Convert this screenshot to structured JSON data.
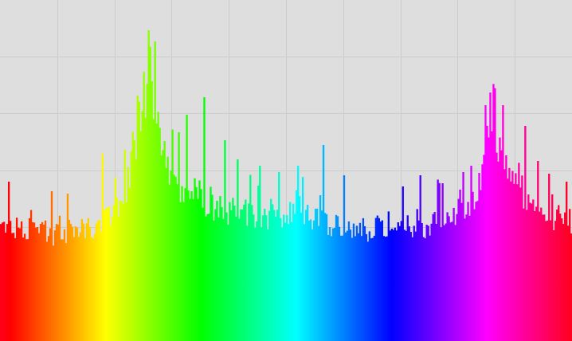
{
  "chart_data": {
    "type": "bar",
    "title": "",
    "xlabel": "",
    "ylabel": "",
    "xlim": [
      0,
      360
    ],
    "ylim": [
      0,
      428
    ],
    "grid": true,
    "grid_x": [
      36,
      72,
      108,
      144,
      180,
      216,
      252,
      288,
      324
    ],
    "grid_y": [
      357,
      286,
      214,
      143,
      71
    ],
    "background": "#dedede",
    "gridline_color": "#cccccc",
    "bar_color": "hue of bin (rainbow)",
    "series": [
      {
        "anchors": [
          [
            0,
            146
          ],
          [
            4,
            144
          ],
          [
            8,
            134
          ],
          [
            12,
            138
          ],
          [
            20,
            140
          ],
          [
            28,
            134
          ],
          [
            36,
            134
          ],
          [
            44,
            138
          ],
          [
            52,
            140
          ],
          [
            60,
            144
          ],
          [
            66,
            152
          ],
          [
            70,
            158
          ],
          [
            76,
            172
          ],
          [
            80,
            192
          ],
          [
            84,
            230
          ],
          [
            88,
            280
          ],
          [
            92,
            290
          ],
          [
            94,
            372
          ],
          [
            96,
            300
          ],
          [
            98,
            278
          ],
          [
            104,
            230
          ],
          [
            108,
            200
          ],
          [
            112,
            188
          ],
          [
            116,
            196
          ],
          [
            120,
            196
          ],
          [
            126,
            182
          ],
          [
            132,
            170
          ],
          [
            136,
            168
          ],
          [
            140,
            168
          ],
          [
            144,
            162
          ],
          [
            150,
            162
          ],
          [
            156,
            162
          ],
          [
            160,
            160
          ],
          [
            164,
            158
          ],
          [
            170,
            156
          ],
          [
            176,
            154
          ],
          [
            180,
            158
          ],
          [
            186,
            156
          ],
          [
            190,
            154
          ],
          [
            196,
            154
          ],
          [
            202,
            152
          ],
          [
            206,
            148
          ],
          [
            212,
            144
          ],
          [
            216,
            146
          ],
          [
            222,
            140
          ],
          [
            228,
            140
          ],
          [
            234,
            140
          ],
          [
            240,
            140
          ],
          [
            246,
            136
          ],
          [
            252,
            136
          ],
          [
            256,
            142
          ],
          [
            262,
            140
          ],
          [
            266,
            144
          ],
          [
            270,
            146
          ],
          [
            274,
            148
          ],
          [
            280,
            154
          ],
          [
            286,
            160
          ],
          [
            292,
            166
          ],
          [
            296,
            170
          ],
          [
            300,
            180
          ],
          [
            304,
            214
          ],
          [
            308,
            262
          ],
          [
            310,
            290
          ],
          [
            312,
            262
          ],
          [
            316,
            226
          ],
          [
            320,
            214
          ],
          [
            324,
            196
          ],
          [
            330,
            186
          ],
          [
            336,
            170
          ],
          [
            342,
            160
          ],
          [
            348,
            156
          ],
          [
            354,
            154
          ],
          [
            360,
            150
          ]
        ],
        "spikes": [
          [
            5,
            200
          ],
          [
            32,
            188
          ],
          [
            42,
            185
          ],
          [
            64,
            235
          ],
          [
            72,
            205
          ],
          [
            78,
            240
          ],
          [
            86,
            308
          ],
          [
            90,
            338
          ],
          [
            93,
            390
          ],
          [
            97,
            376
          ],
          [
            112,
            262
          ],
          [
            117,
            284
          ],
          [
            128,
            306
          ],
          [
            141,
            252
          ],
          [
            149,
            228
          ],
          [
            163,
            220
          ],
          [
            175,
            212
          ],
          [
            187,
            220
          ],
          [
            203,
            246
          ],
          [
            216,
            208
          ],
          [
            253,
            194
          ],
          [
            264,
            208
          ],
          [
            278,
            198
          ],
          [
            289,
            190
          ],
          [
            296,
            220
          ],
          [
            305,
            296
          ],
          [
            316,
            296
          ],
          [
            330,
            270
          ],
          [
            338,
            226
          ],
          [
            345,
            210
          ],
          [
            356,
            200
          ]
        ]
      }
    ]
  }
}
